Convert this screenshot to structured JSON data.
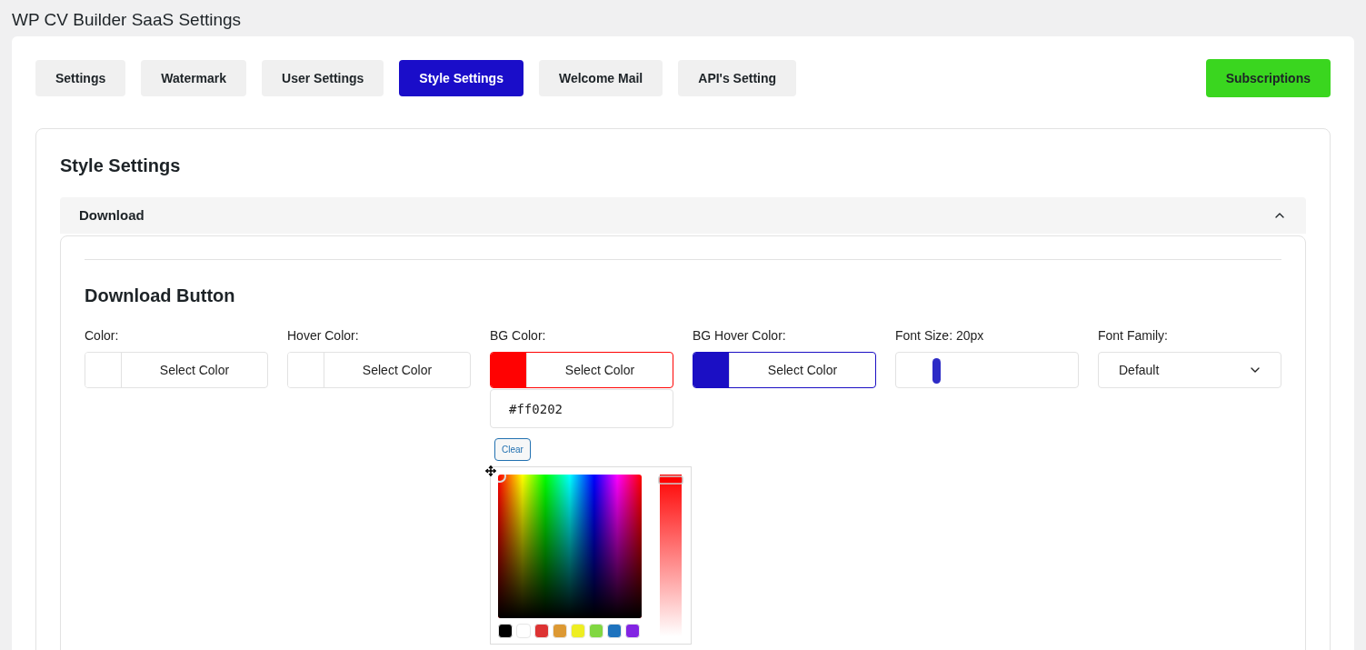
{
  "page_title": "WP CV Builder SaaS Settings",
  "tabs": [
    {
      "label": "Settings",
      "selected": false
    },
    {
      "label": "Watermark",
      "selected": false
    },
    {
      "label": "User Settings",
      "selected": false
    },
    {
      "label": "Style Settings",
      "selected": true
    },
    {
      "label": "Welcome Mail",
      "selected": false
    },
    {
      "label": "API's Setting",
      "selected": false
    }
  ],
  "subscriptions_button": "Subscriptions",
  "section_title": "Style Settings",
  "accordion": {
    "title": "Download",
    "expanded": true
  },
  "subsection_title": "Download Button",
  "fields": [
    {
      "kind": "color",
      "label": "Color:",
      "button": "Select Color"
    },
    {
      "kind": "color",
      "label": "Hover Color:",
      "button": "Select Color"
    },
    {
      "kind": "color",
      "label": "BG Color:",
      "button": "Select Color",
      "color": "#ff0202",
      "picker": {
        "value": "#ff0202",
        "clear": "Clear",
        "palette": [
          {
            "color": "#000000"
          },
          {
            "color": "#ffffff"
          },
          {
            "color": "#dd3333"
          },
          {
            "color": "#dd9933"
          },
          {
            "color": "#eeee22"
          },
          {
            "color": "#81d742"
          },
          {
            "color": "#1e73be"
          },
          {
            "color": "#8224e3"
          }
        ]
      }
    },
    {
      "kind": "color",
      "label": "BG Hover Color:",
      "button": "Select Color",
      "color": "#1b0fc4"
    },
    {
      "kind": "slider",
      "label": "Font Size: 20px",
      "level": 0.2
    },
    {
      "kind": "select",
      "label": "Font Family:",
      "value": "Default"
    }
  ]
}
